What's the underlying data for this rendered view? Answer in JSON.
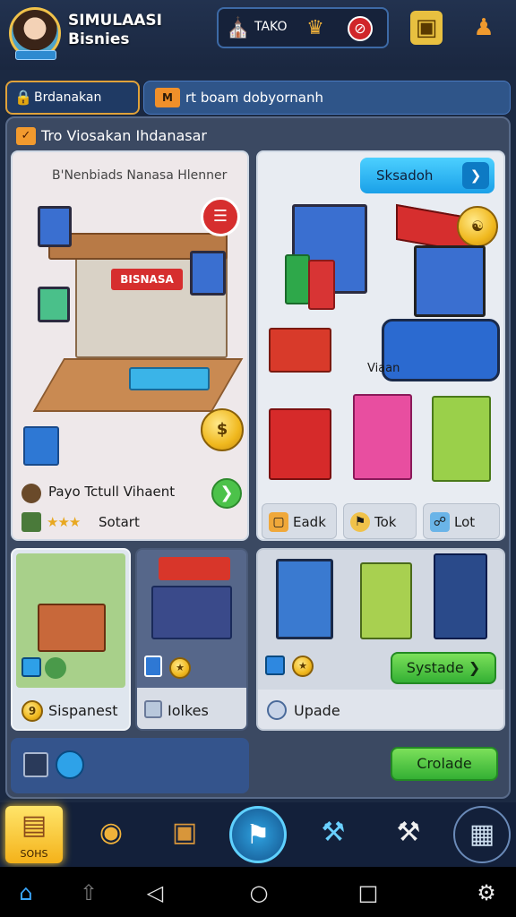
{
  "header": {
    "title": "SIMULAASI Bisnies",
    "currency_label": "TAKO",
    "icons": [
      "avatar",
      "shop-icon",
      "trophy-icon",
      "no-ads-icon",
      "gift-bag-icon",
      "joystick-icon"
    ]
  },
  "tabs": {
    "left_label": "Brdanakan",
    "right_badge": "M",
    "right_label": "rt boam dobyornanh"
  },
  "panel": {
    "title": "Tro Viosakan Ihdanasar"
  },
  "card_a": {
    "caption": "B'Nenbiads Nanasa Hlenner",
    "sign_text": "BISNASA",
    "row1_label": "Payo Tctull Vihaent",
    "row2_stars": "★★★",
    "row2_label": "Sotart"
  },
  "card_b": {
    "button_label": "Sksadoh",
    "vendor_label": "Viaan",
    "chips": [
      {
        "icon": "box-icon",
        "label": "Eadk"
      },
      {
        "icon": "shield-icon",
        "label": "Tok"
      },
      {
        "icon": "phone-icon",
        "label": "Lot"
      }
    ]
  },
  "card_c": {
    "label": "Sispanest",
    "coin_text": "9"
  },
  "card_d": {
    "label": "Iolkes"
  },
  "card_e": {
    "button_label": "Systade",
    "label": "Upade"
  },
  "card_f": {
    "button_label": "Crolade"
  },
  "bottom_nav": {
    "active_label": "SOHS",
    "items": [
      "newspaper-icon",
      "coin-bag-icon",
      "crate-icon",
      "map-icon",
      "tools-icon",
      "hammer-icon",
      "cube-icon"
    ]
  },
  "system_bar": [
    "home-icon",
    "upload-icon",
    "back-icon",
    "circle-icon",
    "square-icon",
    "settings-icon"
  ],
  "colors": {
    "background": "#1b2942",
    "accent_gold": "#f0c24a",
    "accent_green": "#4cc24a",
    "accent_blue": "#1aa0e8"
  }
}
